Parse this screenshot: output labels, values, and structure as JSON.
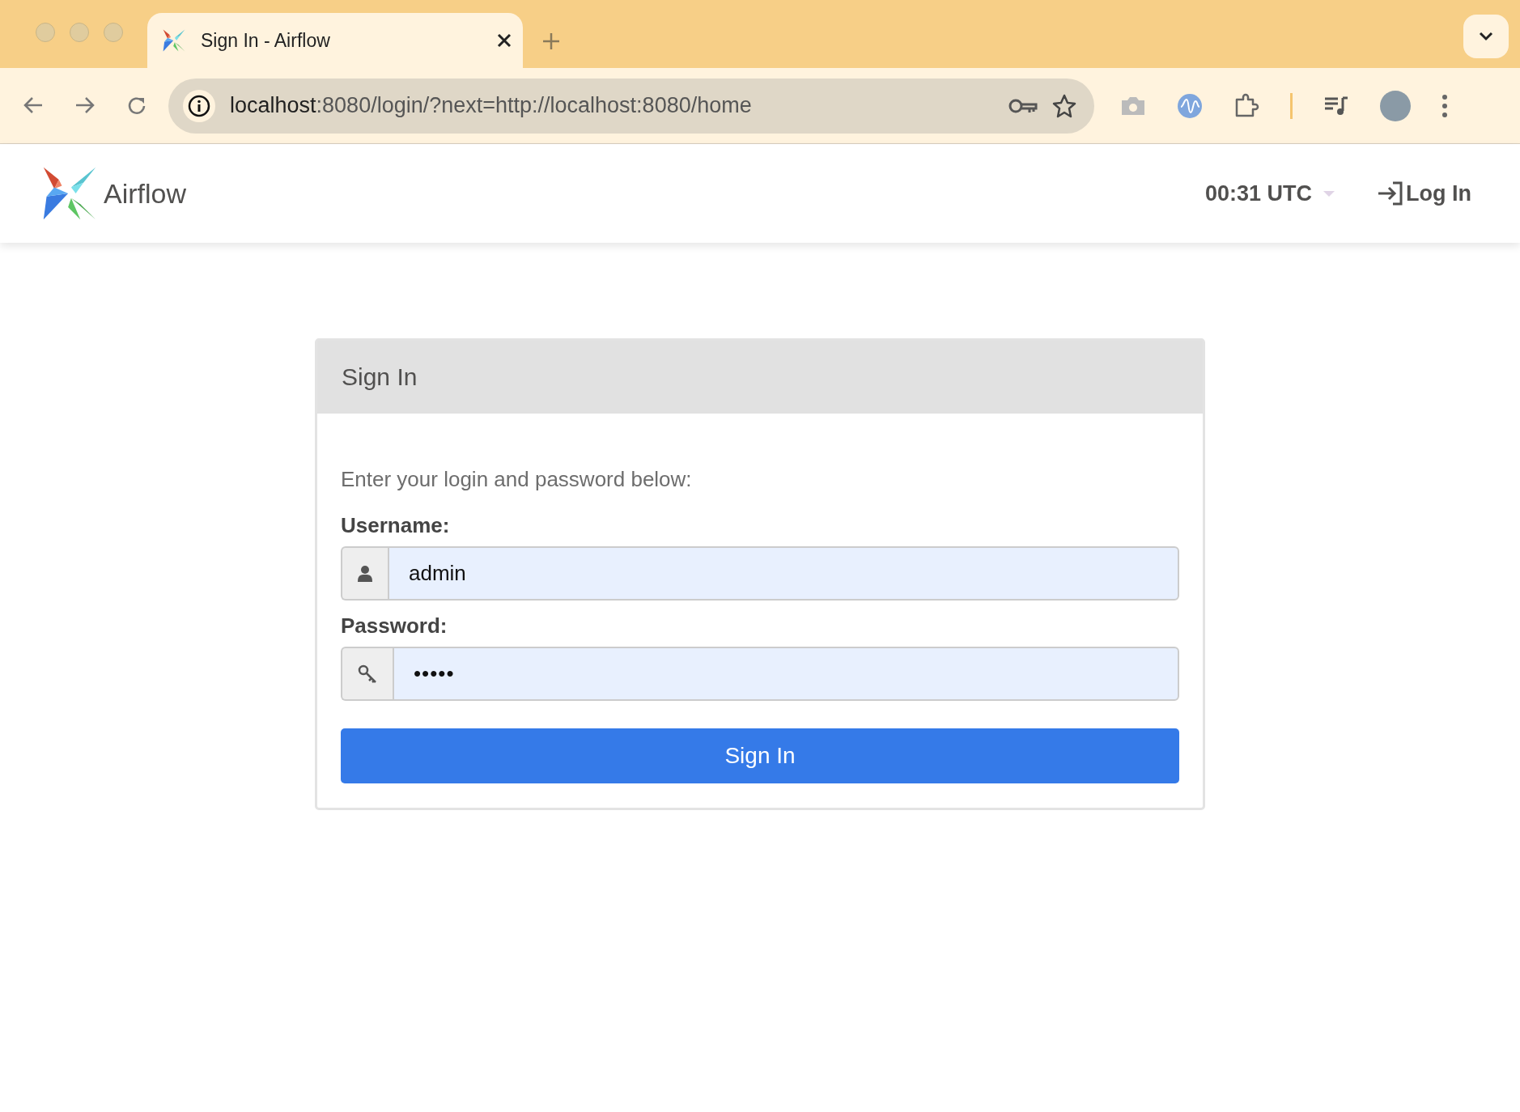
{
  "browser": {
    "tab_title": "Sign In - Airflow",
    "address": {
      "host": "localhost",
      "path": ":8080/login/?next=http://localhost:8080/home"
    }
  },
  "navbar": {
    "brand": "Airflow",
    "clock": "00:31 UTC",
    "login_link": "Log In"
  },
  "login": {
    "title": "Sign In",
    "intro": "Enter your login and password below:",
    "fields": [
      {
        "kind": "text",
        "label": "Username:",
        "value": "admin"
      },
      {
        "kind": "password",
        "label": "Password:",
        "value": "•••••"
      }
    ],
    "submit": "Sign In"
  }
}
